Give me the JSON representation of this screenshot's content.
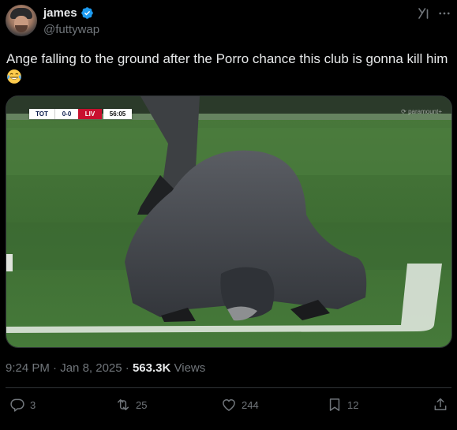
{
  "author": {
    "display_name": "james",
    "handle": "@futtywap",
    "verified": true
  },
  "tweet": {
    "text": "Ange falling to the ground after the Porro chance this club is gonna kill him",
    "emoji": "face-with-tears-of-joy"
  },
  "media": {
    "scoreboard": {
      "home": "TOT",
      "score": "0-0",
      "away": "LIV",
      "clock": "56:05"
    },
    "watermark": "⟳ paramount+"
  },
  "meta": {
    "time": "9:24 PM",
    "separator": "·",
    "date": "Jan 8, 2025",
    "views_count": "563.3K",
    "views_label": "Views"
  },
  "actions": {
    "replies": "3",
    "reposts": "25",
    "likes": "244",
    "bookmarks": "12"
  },
  "colors": {
    "background": "#000000",
    "text": "#e7e9ea",
    "muted": "#71767b",
    "verified": "#1d9bf0",
    "divider": "#2f3336"
  },
  "icons": [
    "verified-badge-icon",
    "grok-icon",
    "more-icon",
    "reply-icon",
    "retweet-icon",
    "like-icon",
    "bookmark-icon",
    "share-icon"
  ]
}
